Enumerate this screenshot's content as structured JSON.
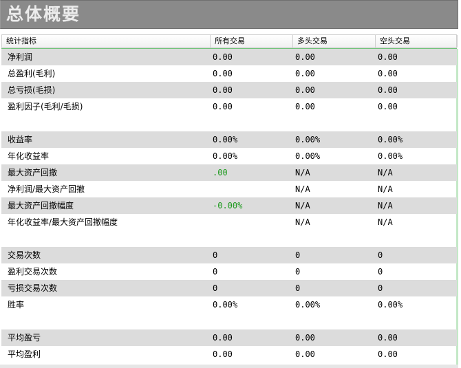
{
  "title": "总体概要",
  "colors": {
    "title_bg": "#8a8a8a",
    "row_shade": "#dcdcdc",
    "green_value": "#1f9a1f",
    "accent_line": "#72c47a"
  },
  "table": {
    "headers": [
      "统计指标",
      "所有交易",
      "多头交易",
      "空头交易"
    ],
    "rows": [
      {
        "label": "净利润",
        "all": "0.00",
        "long": "0.00",
        "short": "0.00"
      },
      {
        "label": "总盈利(毛利)",
        "all": "0.00",
        "long": "0.00",
        "short": "0.00"
      },
      {
        "label": "总亏损(毛损)",
        "all": "0.00",
        "long": "0.00",
        "short": "0.00"
      },
      {
        "label": "盈利因子(毛利/毛损)",
        "all": "0.00",
        "long": "0.00",
        "short": "0.00"
      },
      {
        "label": "收益率",
        "all": "0.00%",
        "long": "0.00%",
        "short": "0.00%"
      },
      {
        "label": "年化收益率",
        "all": "0.00%",
        "long": "0.00%",
        "short": "0.00%"
      },
      {
        "label": "最大资产回撤",
        "all": ".00",
        "long": "N/A",
        "short": "N/A"
      },
      {
        "label": "净利润/最大资产回撤",
        "all": "",
        "long": "N/A",
        "short": "N/A"
      },
      {
        "label": "最大资产回撤幅度",
        "all": "-0.00%",
        "long": "N/A",
        "short": "N/A"
      },
      {
        "label": "年化收益率/最大资产回撤幅度",
        "all": "",
        "long": "N/A",
        "short": "N/A"
      },
      {
        "label": "交易次数",
        "all": "0",
        "long": "0",
        "short": "0"
      },
      {
        "label": "盈利交易次数",
        "all": "0",
        "long": "0",
        "short": "0"
      },
      {
        "label": "亏损交易次数",
        "all": "0",
        "long": "0",
        "short": "0"
      },
      {
        "label": "胜率",
        "all": "0.00%",
        "long": "0.00%",
        "short": "0.00%"
      },
      {
        "label": "平均盈亏",
        "all": "0.00",
        "long": "0.00",
        "short": "0.00"
      },
      {
        "label": "平均盈利",
        "all": "0.00",
        "long": "0.00",
        "short": "0.00"
      }
    ]
  }
}
